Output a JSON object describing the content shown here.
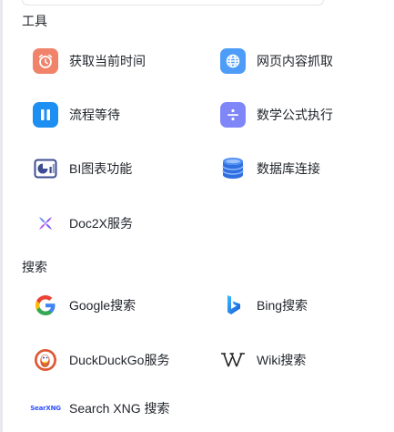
{
  "sections": {
    "tools": {
      "title": "工具",
      "items": [
        {
          "label": "获取当前时间",
          "icon": "alarm-clock-icon",
          "color": "#f0836a"
        },
        {
          "label": "网页内容抓取",
          "icon": "globe-icon",
          "color": "#4d9cf8"
        },
        {
          "label": "流程等待",
          "icon": "pause-icon",
          "color": "#1d8ef2"
        },
        {
          "label": "数学公式执行",
          "icon": "divide-icon",
          "color": "#7f86f7"
        },
        {
          "label": "BI图表功能",
          "icon": "chart-icon",
          "color": "#3d4d91"
        },
        {
          "label": "数据库连接",
          "icon": "database-icon",
          "color": "#3a78e8"
        },
        {
          "label": "Doc2X服务",
          "icon": "doc2x-logo-icon",
          "color": "#7b5cf5"
        }
      ]
    },
    "search": {
      "title": "搜索",
      "items": [
        {
          "label": "Google搜索",
          "icon": "google-logo-icon"
        },
        {
          "label": "Bing搜索",
          "icon": "bing-logo-icon"
        },
        {
          "label": "DuckDuckGo服务",
          "icon": "duckduckgo-logo-icon"
        },
        {
          "label": "Wiki搜索",
          "icon": "wikipedia-logo-icon"
        },
        {
          "label": "Search XNG 搜索",
          "icon": "searxng-logo-icon",
          "logo_text": "SearXNG"
        }
      ]
    }
  }
}
